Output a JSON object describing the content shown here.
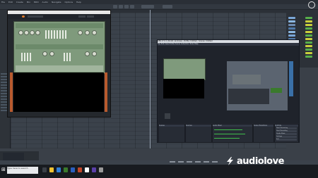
{
  "menubar": {
    "items": [
      "File",
      "Edit",
      "Create",
      "Mix",
      "MIDI",
      "Audio",
      "Navigate",
      "Options",
      "Help"
    ]
  },
  "brand": {
    "accent": "#3a7a2c",
    "rack_color": "#7f9a7c",
    "dark": "#24282d"
  },
  "plugin": {
    "title": "",
    "placeholder_text": "",
    "tabs": [
      "Browse",
      "Rack"
    ]
  },
  "obs": {
    "title": "OBS 27.0.1 (64-bit, windows) - Profile: Untitled - Scenes: Untitled",
    "menu": [
      "File",
      "Edit",
      "View",
      "Profile",
      "Scene Collection",
      "Tools",
      "Help"
    ],
    "docks": [
      "Scenes",
      "Sources",
      "Audio Mixer",
      "Scene Transitions",
      "Controls"
    ],
    "controls": [
      "Start Streaming",
      "Start Recording",
      "Studio Mode",
      "Settings",
      "Exit"
    ]
  },
  "taskbar": {
    "search_placeholder": "Type here to search"
  },
  "watermark": {
    "text": "audiolove",
    "icon": "lightning-icon"
  }
}
